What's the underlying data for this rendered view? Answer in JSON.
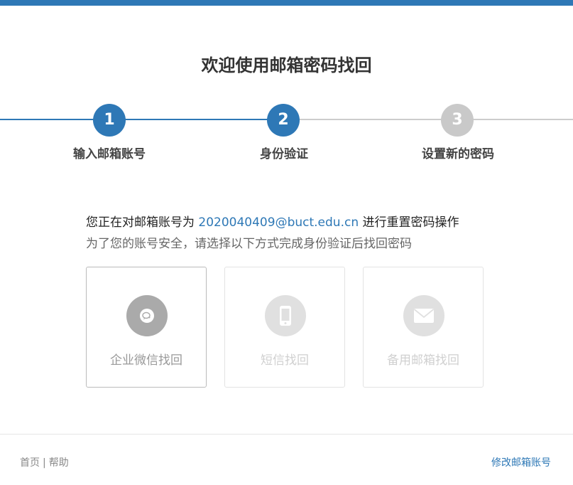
{
  "title": "欢迎使用邮箱密码找回",
  "steps": [
    {
      "number": "1",
      "label": "输入邮箱账号",
      "state": "done"
    },
    {
      "number": "2",
      "label": "身份验证",
      "state": "current"
    },
    {
      "number": "3",
      "label": "设置新的密码",
      "state": "pending"
    }
  ],
  "intro": {
    "prefix": "您正在对邮箱账号为",
    "email": "2020040409@buct.edu.cn",
    "suffix": "进行重置密码操作",
    "sub": "为了您的账号安全，请选择以下方式完成身份验证后找回密码"
  },
  "options": [
    {
      "label": "企业微信找回",
      "icon": "wechat-work-icon",
      "state": "selected"
    },
    {
      "label": "短信找回",
      "icon": "phone-icon",
      "state": "disabled"
    },
    {
      "label": "备用邮箱找回",
      "icon": "mail-icon",
      "state": "disabled"
    }
  ],
  "footer": {
    "home": "首页",
    "separator": "|",
    "help": "帮助",
    "change_account": "修改邮箱账号"
  },
  "colors": {
    "accent": "#2e78b6",
    "pending": "#c9c9c9"
  }
}
